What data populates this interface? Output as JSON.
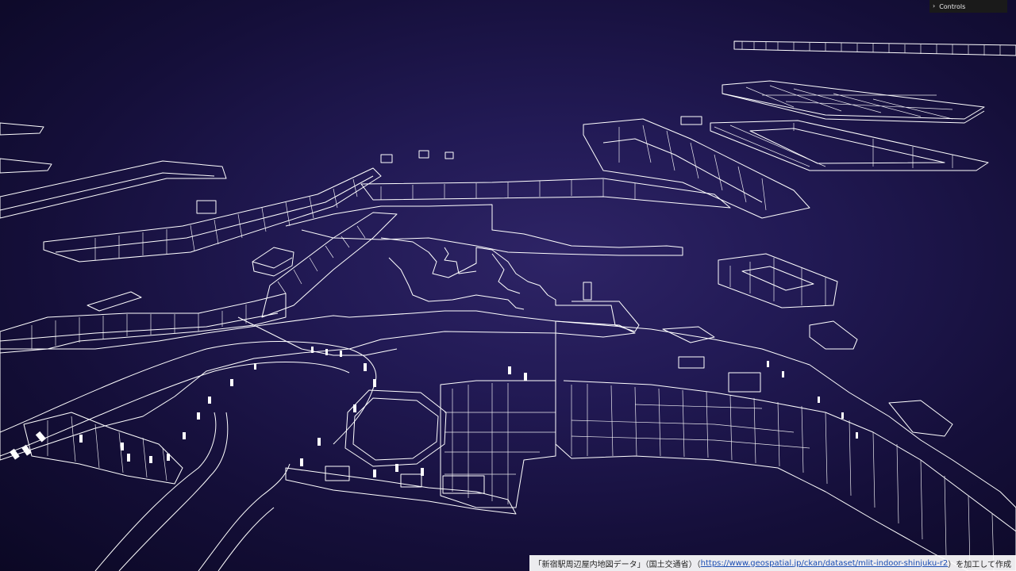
{
  "controls": {
    "label": "Controls",
    "chevron_icon": "chevron-right-icon"
  },
  "attribution": {
    "prefix": "「新宿駅周辺屋内地図データ」（国土交通省）（",
    "link_text": "https://www.geospatial.jp/ckan/dataset/mlit-indoor-shinjuku-r2",
    "suffix": "）を加工して作成"
  },
  "scene": {
    "wire_color": "#ffffff",
    "background_color": "#1e1750"
  }
}
